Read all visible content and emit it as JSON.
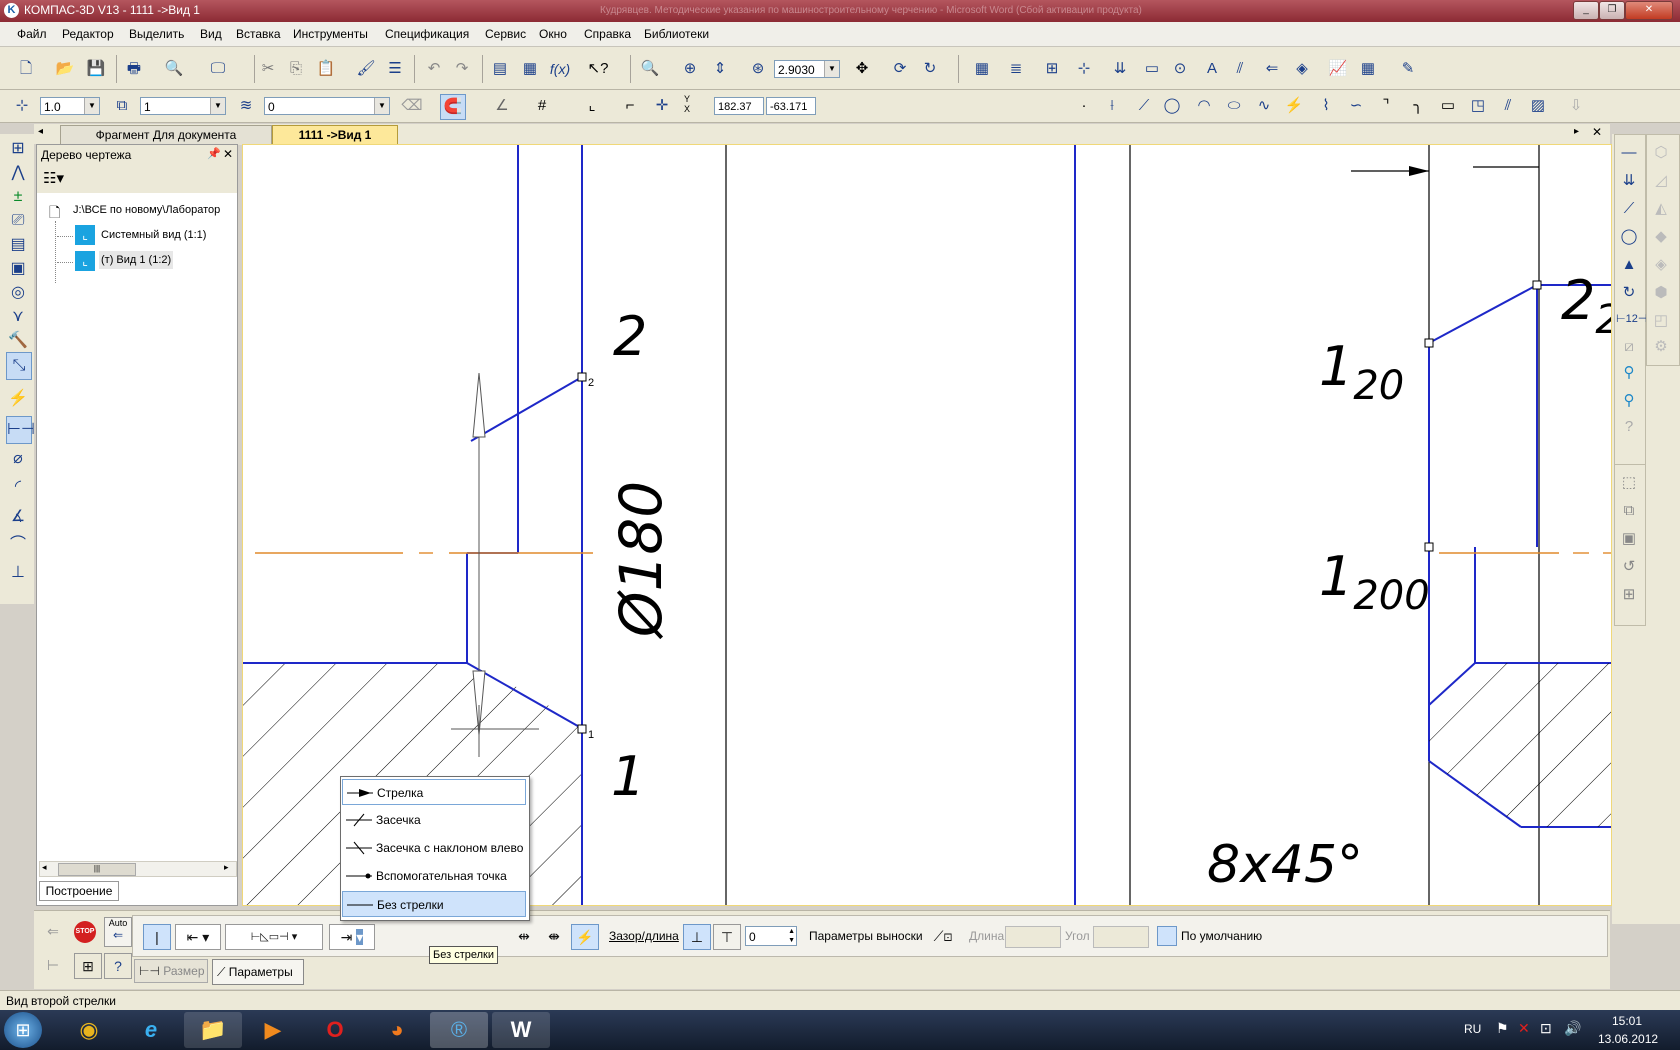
{
  "window": {
    "app_icon": "kompas-logo-icon",
    "title": "КОМПАС-3D V13 - 1111 ->Вид 1",
    "faded_title": "Кудрявцев. Методические указания по машиностроительному черчению - Microsoft Word (Сбой активации продукта)"
  },
  "menu": [
    "Файл",
    "Редактор",
    "Выделить",
    "Вид",
    "Вставка",
    "Инструменты",
    "Спецификация",
    "Сервис",
    "Окно",
    "Справка",
    "Библиотеки"
  ],
  "toolbar1": {
    "zoom_value": "2.9030"
  },
  "toolbar2": {
    "line_scale": "1.0",
    "style_value": "1",
    "layer_value": "0",
    "coord_x": "182.37",
    "coord_y": "-63.171",
    "coord_label": "Y X"
  },
  "tabs": [
    {
      "label": "Фрагмент Для документа",
      "active": false
    },
    {
      "label": "1111 ->Вид 1",
      "active": true
    }
  ],
  "tree": {
    "title": "Дерево чертежа",
    "root": "J:\\ВСЕ по новому\\Лаборатор",
    "items": [
      "Системный вид (1:1)",
      "(т) Вид 1 (1:2)"
    ],
    "bottom_tab": "Построение"
  },
  "drawing": {
    "labels": {
      "num2": "2",
      "diameter": "Ø180",
      "num1": "1",
      "l20": "1",
      "l20sub": "20",
      "l200": "1",
      "l200sub": "200",
      "chamfer": "8x45°",
      "r22": "2",
      "r22sub": "2",
      "pt2": "2",
      "pt1": "1"
    },
    "colors": {
      "line": "#1e28c8",
      "black": "#000000",
      "axis": "#e08a2c"
    }
  },
  "dropdown": {
    "items": [
      {
        "label": "Стрелка",
        "icon": "arrow-end-icon"
      },
      {
        "label": "Засечка",
        "icon": "tick-mark-icon"
      },
      {
        "label": "Засечка с наклоном влево",
        "icon": "tick-left-icon"
      },
      {
        "label": "Вспомогательная точка",
        "icon": "aux-point-icon"
      },
      {
        "label": "Без стрелки",
        "icon": "no-arrow-icon"
      }
    ],
    "tooltip": "Без стрелки"
  },
  "props": {
    "stop": "STOP",
    "auto": "Auto",
    "gap_label": "Зазор/длина",
    "gap_value": "0",
    "leader_label": "Параметры выноски",
    "length_label": "Длина",
    "angle_label": "Угол",
    "default_label": "По умолчанию",
    "tab_size": "Размер",
    "tab_params": "Параметры"
  },
  "status": "Вид второй стрелки",
  "taskbar": {
    "lang": "RU",
    "time": "15:01",
    "date": "13.06.2012"
  }
}
